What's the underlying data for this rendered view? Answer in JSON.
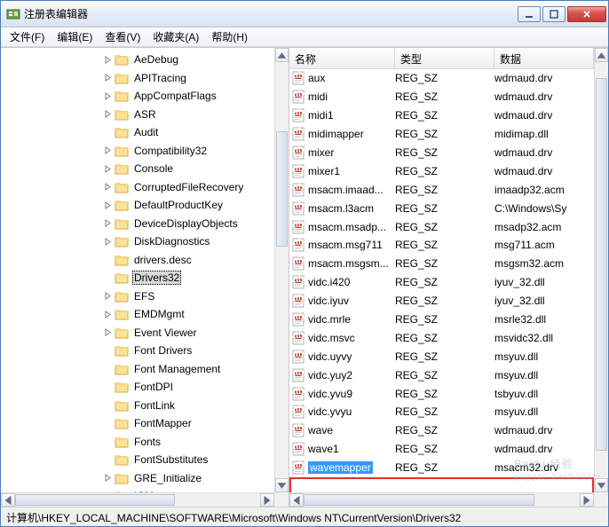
{
  "window": {
    "title": "注册表编辑器"
  },
  "menu": {
    "file": "文件(F)",
    "edit": "编辑(E)",
    "view": "查看(V)",
    "favorites": "收藏夹(A)",
    "help": "帮助(H)"
  },
  "tree": {
    "items": [
      {
        "expandable": true,
        "label": "AeDebug"
      },
      {
        "expandable": true,
        "label": "APITracing"
      },
      {
        "expandable": true,
        "label": "AppCompatFlags"
      },
      {
        "expandable": true,
        "label": "ASR"
      },
      {
        "expandable": false,
        "label": "Audit"
      },
      {
        "expandable": true,
        "label": "Compatibility32"
      },
      {
        "expandable": true,
        "label": "Console"
      },
      {
        "expandable": true,
        "label": "CorruptedFileRecovery"
      },
      {
        "expandable": true,
        "label": "DefaultProductKey"
      },
      {
        "expandable": true,
        "label": "DeviceDisplayObjects"
      },
      {
        "expandable": true,
        "label": "DiskDiagnostics"
      },
      {
        "expandable": false,
        "label": "drivers.desc"
      },
      {
        "expandable": false,
        "label": "Drivers32",
        "selected": true
      },
      {
        "expandable": true,
        "label": "EFS"
      },
      {
        "expandable": true,
        "label": "EMDMgmt"
      },
      {
        "expandable": true,
        "label": "Event Viewer"
      },
      {
        "expandable": false,
        "label": "Font Drivers"
      },
      {
        "expandable": false,
        "label": "Font Management"
      },
      {
        "expandable": false,
        "label": "FontDPI"
      },
      {
        "expandable": false,
        "label": "FontLink"
      },
      {
        "expandable": false,
        "label": "FontMapper"
      },
      {
        "expandable": false,
        "label": "Fonts"
      },
      {
        "expandable": false,
        "label": "FontSubstitutes"
      },
      {
        "expandable": true,
        "label": "GRE_Initialize"
      },
      {
        "expandable": true,
        "label": "ICM"
      }
    ]
  },
  "list": {
    "cols": {
      "name": "名称",
      "type": "类型",
      "data": "数据"
    },
    "rows": [
      {
        "name": "aux",
        "type": "REG_SZ",
        "data": "wdmaud.drv"
      },
      {
        "name": "midi",
        "type": "REG_SZ",
        "data": "wdmaud.drv"
      },
      {
        "name": "midi1",
        "type": "REG_SZ",
        "data": "wdmaud.drv"
      },
      {
        "name": "midimapper",
        "type": "REG_SZ",
        "data": "midimap.dll"
      },
      {
        "name": "mixer",
        "type": "REG_SZ",
        "data": "wdmaud.drv"
      },
      {
        "name": "mixer1",
        "type": "REG_SZ",
        "data": "wdmaud.drv"
      },
      {
        "name": "msacm.imaad...",
        "type": "REG_SZ",
        "data": "imaadp32.acm"
      },
      {
        "name": "msacm.l3acm",
        "type": "REG_SZ",
        "data": "C:\\Windows\\Sy"
      },
      {
        "name": "msacm.msadp...",
        "type": "REG_SZ",
        "data": "msadp32.acm"
      },
      {
        "name": "msacm.msg711",
        "type": "REG_SZ",
        "data": "msg711.acm"
      },
      {
        "name": "msacm.msgsm...",
        "type": "REG_SZ",
        "data": "msgsm32.acm"
      },
      {
        "name": "vidc.i420",
        "type": "REG_SZ",
        "data": "iyuv_32.dll"
      },
      {
        "name": "vidc.iyuv",
        "type": "REG_SZ",
        "data": "iyuv_32.dll"
      },
      {
        "name": "vidc.mrle",
        "type": "REG_SZ",
        "data": "msrle32.dll"
      },
      {
        "name": "vidc.msvc",
        "type": "REG_SZ",
        "data": "msvidc32.dll"
      },
      {
        "name": "vidc.uyvy",
        "type": "REG_SZ",
        "data": "msyuv.dll"
      },
      {
        "name": "vidc.yuy2",
        "type": "REG_SZ",
        "data": "msyuv.dll"
      },
      {
        "name": "vidc.yvu9",
        "type": "REG_SZ",
        "data": "tsbyuv.dll"
      },
      {
        "name": "vidc.yvyu",
        "type": "REG_SZ",
        "data": "msyuv.dll"
      },
      {
        "name": "wave",
        "type": "REG_SZ",
        "data": "wdmaud.drv"
      },
      {
        "name": "wave1",
        "type": "REG_SZ",
        "data": "wdmaud.drv"
      },
      {
        "name": "wavemapper",
        "type": "REG_SZ",
        "data": "msacm32.drv",
        "selected": true
      }
    ]
  },
  "status": {
    "path": "计算机\\HKEY_LOCAL_MACHINE\\SOFTWARE\\Microsoft\\Windows NT\\CurrentVersion\\Drivers32"
  },
  "watermark": {
    "big": "Baidu 经验",
    "small": "jingyan.baidu.com"
  }
}
